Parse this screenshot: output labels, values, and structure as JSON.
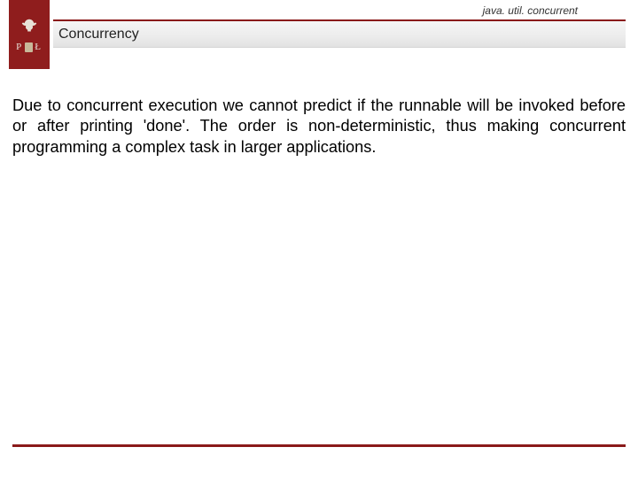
{
  "header": {
    "package_name": "java. util. concurrent",
    "title": "Concurrency",
    "logo": {
      "left_letter": "P",
      "right_letter": "Ł"
    }
  },
  "body": {
    "paragraph": "Due to concurrent execution we cannot predict if the runnable will be invoked before or after printing 'done'. The order is non-deterministic, thus making concurrent programming a complex task in larger applications."
  },
  "colors": {
    "accent": "#8a1a1a",
    "logo_bg": "#8f1d1d"
  }
}
